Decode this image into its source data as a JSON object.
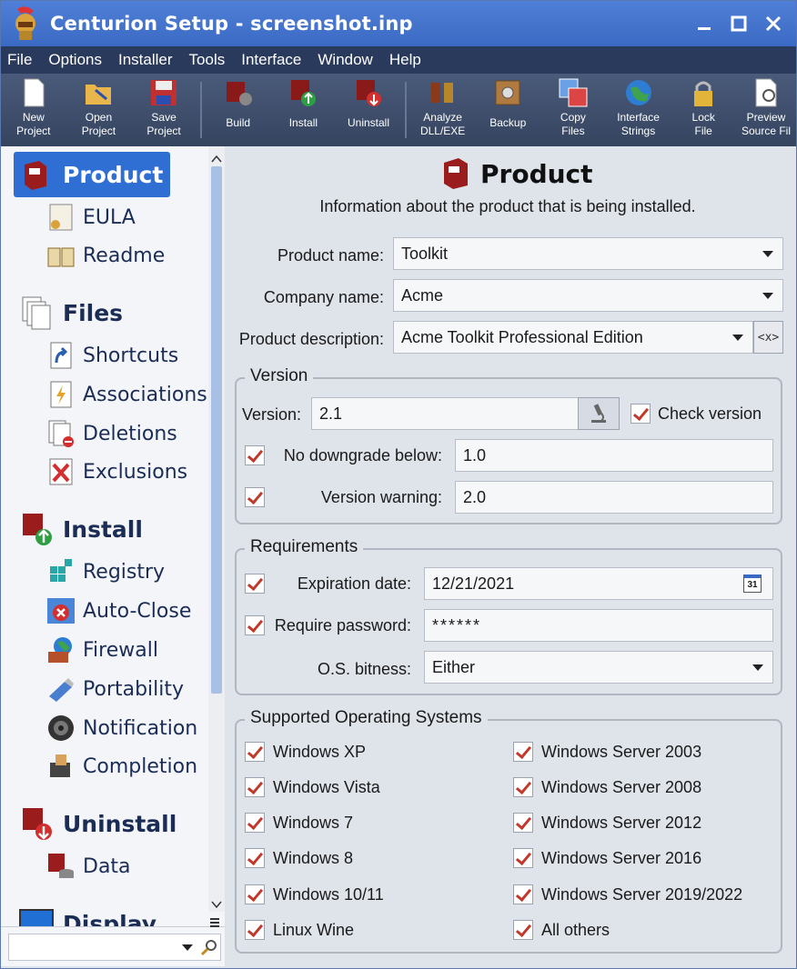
{
  "window": {
    "title": "Centurion Setup - screenshot.inp"
  },
  "menu": [
    "File",
    "Options",
    "Installer",
    "Tools",
    "Interface",
    "Window",
    "Help"
  ],
  "toolbar": [
    {
      "label": "New\nProject",
      "icon": "new-project-icon"
    },
    {
      "label": "Open\nProject",
      "icon": "open-project-icon"
    },
    {
      "label": "Save\nProject",
      "icon": "save-project-icon"
    },
    {
      "label": "Build",
      "icon": "build-icon"
    },
    {
      "label": "Install",
      "icon": "install-icon"
    },
    {
      "label": "Uninstall",
      "icon": "uninstall-icon"
    },
    {
      "label": "Analyze\nDLL/EXE",
      "icon": "analyze-icon"
    },
    {
      "label": "Backup",
      "icon": "backup-icon"
    },
    {
      "label": "Copy\nFiles",
      "icon": "copy-files-icon"
    },
    {
      "label": "Interface\nStrings",
      "icon": "interface-strings-icon"
    },
    {
      "label": "Lock\nFile",
      "icon": "lock-file-icon"
    },
    {
      "label": "Preview\nSource Fil",
      "icon": "preview-source-icon"
    }
  ],
  "sidebar": {
    "categories": [
      {
        "label": "Product",
        "icon": "product-box-icon",
        "active": true
      },
      {
        "label": "Files",
        "icon": "files-icon"
      },
      {
        "label": "Install",
        "icon": "install-box-icon"
      },
      {
        "label": "Uninstall",
        "icon": "uninstall-box-icon"
      },
      {
        "label": "Display",
        "icon": "display-icon"
      }
    ],
    "items": {
      "product": [
        "EULA",
        "Readme"
      ],
      "files": [
        "Shortcuts",
        "Associations",
        "Deletions",
        "Exclusions"
      ],
      "install": [
        "Registry",
        "Auto-Close",
        "Firewall",
        "Portability",
        "Notification",
        "Completion"
      ],
      "uninstall": [
        "Data"
      ]
    }
  },
  "main": {
    "title": "Product",
    "subtitle": "Information about the product that is being installed.",
    "product_name_label": "Product name:",
    "product_name": "Toolkit",
    "company_name_label": "Company name:",
    "company_name": "Acme",
    "product_description_label": "Product description:",
    "product_description": "Acme Toolkit Professional Edition",
    "macro_button": "<x>",
    "version_group": {
      "title": "Version",
      "version_label": "Version:",
      "version": "2.1",
      "check_version_label": "Check version",
      "no_downgrade_label": "No downgrade below:",
      "no_downgrade": "1.0",
      "version_warning_label": "Version warning:",
      "version_warning": "2.0"
    },
    "requirements_group": {
      "title": "Requirements",
      "expiration_label": "Expiration date:",
      "expiration": "12/21/2021",
      "calendar_day": "31",
      "password_label": "Require password:",
      "password": "******",
      "bitness_label": "O.S. bitness:",
      "bitness": "Either"
    },
    "os_group": {
      "title": "Supported Operating Systems",
      "left": [
        "Windows XP",
        "Windows Vista",
        "Windows 7",
        "Windows 8",
        "Windows 10/11",
        "Linux Wine"
      ],
      "right": [
        "Windows Server 2003",
        "Windows Server 2008",
        "Windows Server 2012",
        "Windows Server 2016",
        "Windows Server 2019/2022",
        "All others"
      ]
    }
  },
  "colors": {
    "titlebar": "#3f70cc",
    "menubar": "#2a3a5c",
    "accent": "#2f6fd4",
    "check": "#c0392b"
  }
}
